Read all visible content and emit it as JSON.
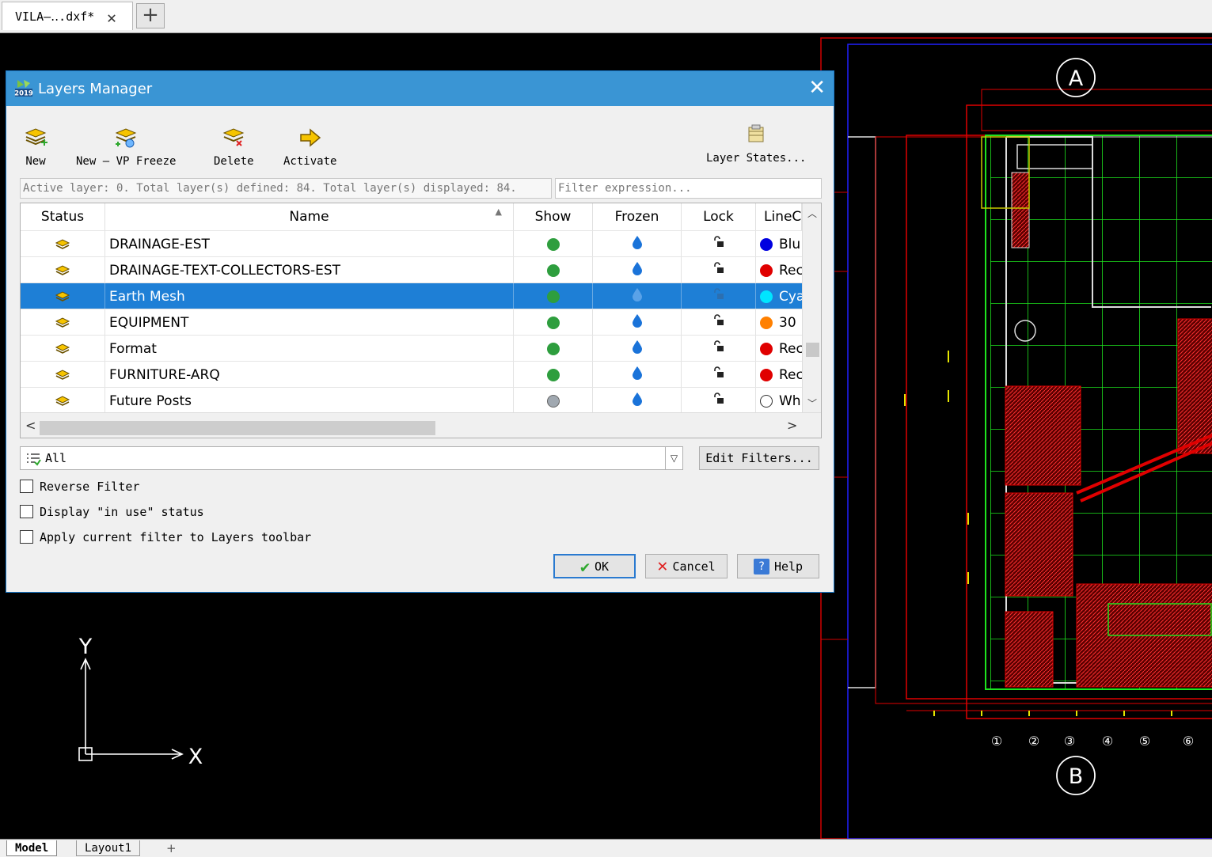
{
  "tabs": {
    "doc_title": "VILA—‥.dxf*",
    "close_glyph": "✕",
    "new_tab_glyph": "+"
  },
  "bottom_tabs": [
    {
      "label": "Model"
    },
    {
      "label": "Layout1"
    },
    {
      "label": "+"
    }
  ],
  "cad": {
    "grid_bubbles": [
      "A",
      "B"
    ],
    "column_markers": [
      "①",
      "②",
      "③",
      "④",
      "⑤",
      "⑥"
    ],
    "axis_labels": {
      "x": "X",
      "y": "Y"
    }
  },
  "dialog": {
    "title": "Layers Manager",
    "logo_text": "2019",
    "toolbar": {
      "new": "New",
      "new_vp_freeze": "New — VP Freeze",
      "delete": "Delete",
      "activate": "Activate",
      "layer_states": "Layer States..."
    },
    "status_text": "Active layer: 0. Total layer(s) defined: 84. Total layer(s) displayed: 84.",
    "filter_placeholder": "Filter expression...",
    "columns": {
      "status": "Status",
      "name": "Name",
      "show": "Show",
      "frozen": "Frozen",
      "lock": "Lock",
      "linecolor": "LineC"
    },
    "layers": [
      {
        "name": "DRAINAGE-EST",
        "show": "on",
        "color_label": "Blu",
        "color": "#0000e0",
        "selected": false
      },
      {
        "name": "DRAINAGE-TEXT-COLLECTORS-EST",
        "show": "on",
        "color_label": "Rec",
        "color": "#e00000",
        "selected": false
      },
      {
        "name": "Earth Mesh",
        "show": "on",
        "color_label": "Cya",
        "color": "#00e5ff",
        "selected": true
      },
      {
        "name": "EQUIPMENT",
        "show": "on",
        "color_label": "30",
        "color": "#ff8000",
        "selected": false
      },
      {
        "name": "Format",
        "show": "on",
        "color_label": "Rec",
        "color": "#e00000",
        "selected": false
      },
      {
        "name": "FURNITURE-ARQ",
        "show": "on",
        "color_label": "Rec",
        "color": "#e00000",
        "selected": false
      },
      {
        "name": "Future Posts",
        "show": "off",
        "color_label": "Wh",
        "color": "#ffffff",
        "selected": false
      }
    ],
    "colors": {
      "show_on": "#2e9e3e",
      "show_off": "#a0a8b0",
      "frozen_drop": "#1a73d9",
      "title_bar": "#3a95d4",
      "selection": "#1e7fd6"
    },
    "filter_select": {
      "value": "All"
    },
    "edit_filters": "Edit Filters...",
    "checkboxes": [
      {
        "label": "Reverse Filter",
        "checked": false
      },
      {
        "label": "Display \"in use\" status",
        "checked": false
      },
      {
        "label": "Apply current filter to Layers toolbar",
        "checked": false
      }
    ],
    "buttons": {
      "ok": "OK",
      "cancel": "Cancel",
      "help": "Help"
    }
  }
}
